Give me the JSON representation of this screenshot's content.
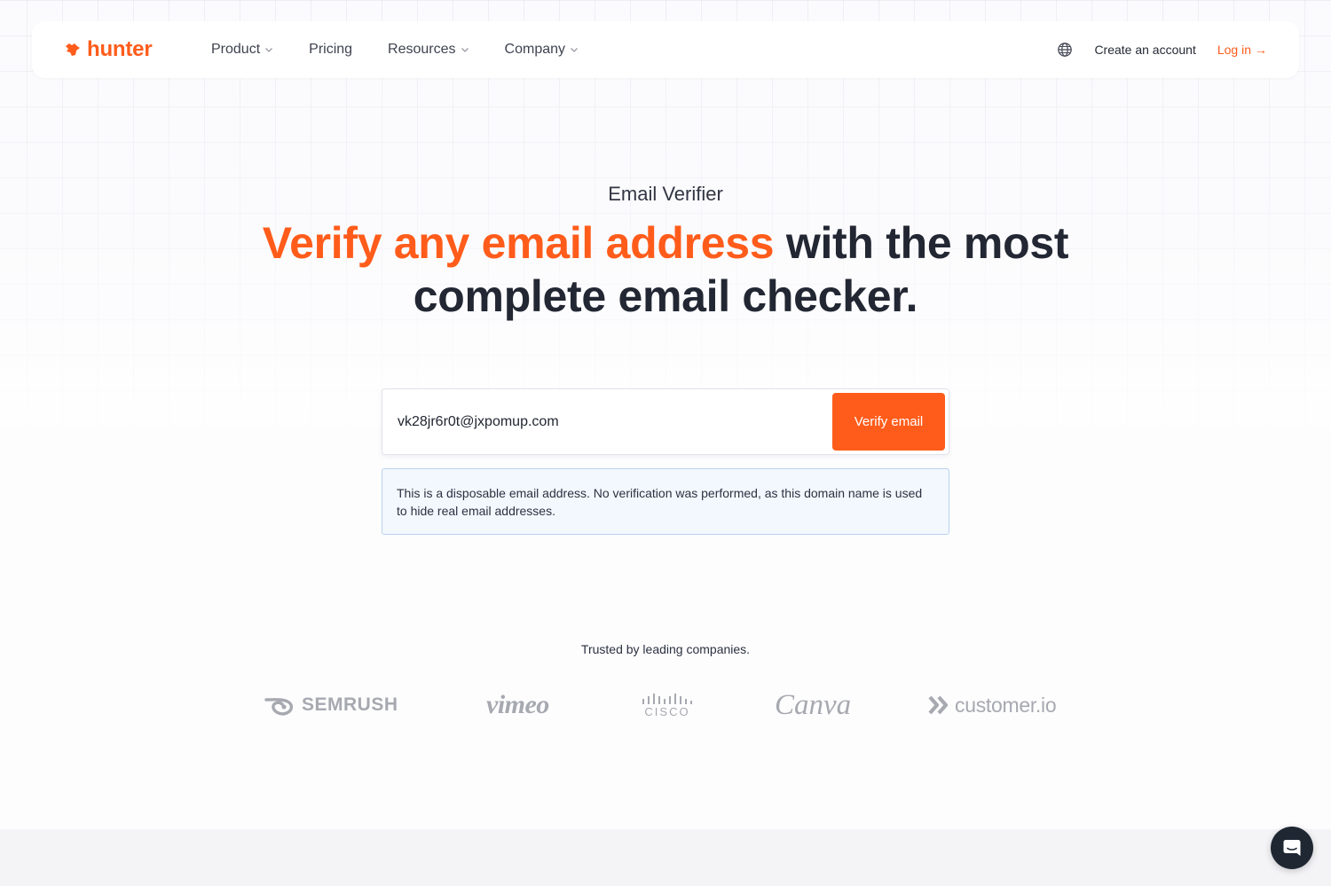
{
  "brand": {
    "name": "hunter",
    "accent_color": "#ff5c1b",
    "logo_icon": "hunter-fox-icon"
  },
  "nav": {
    "items": [
      {
        "label": "Product",
        "has_dropdown": true
      },
      {
        "label": "Pricing",
        "has_dropdown": false
      },
      {
        "label": "Resources",
        "has_dropdown": true
      },
      {
        "label": "Company",
        "has_dropdown": true
      }
    ],
    "language_icon": "globe-icon",
    "create_account": "Create an account",
    "login": "Log in",
    "login_arrow": "→"
  },
  "hero": {
    "eyebrow": "Email Verifier",
    "headline_accent": "Verify any email address",
    "headline_rest": " with the most complete email checker."
  },
  "verify_form": {
    "email_value": "vk28jr6r0t@jxpomup.com",
    "button_label": "Verify email",
    "button_color": "#ff5c1b"
  },
  "notice": {
    "text": "This is a disposable email address. No verification was performed, as this domain name is used to hide real email addresses.",
    "background": "#f3f8fe",
    "border": "#b9d3ee"
  },
  "trusted": {
    "title": "Trusted by leading companies.",
    "logos": [
      {
        "name": "SEMRUSH",
        "icon": "semrush-fireball-icon"
      },
      {
        "name": "vimeo"
      },
      {
        "name": "CISCO",
        "icon": "cisco-bars-icon"
      },
      {
        "name": "Canva"
      },
      {
        "name": "customer.io",
        "icon": "customerio-chevrons-icon"
      }
    ]
  },
  "chat": {
    "icon": "chat-bubble-icon"
  }
}
